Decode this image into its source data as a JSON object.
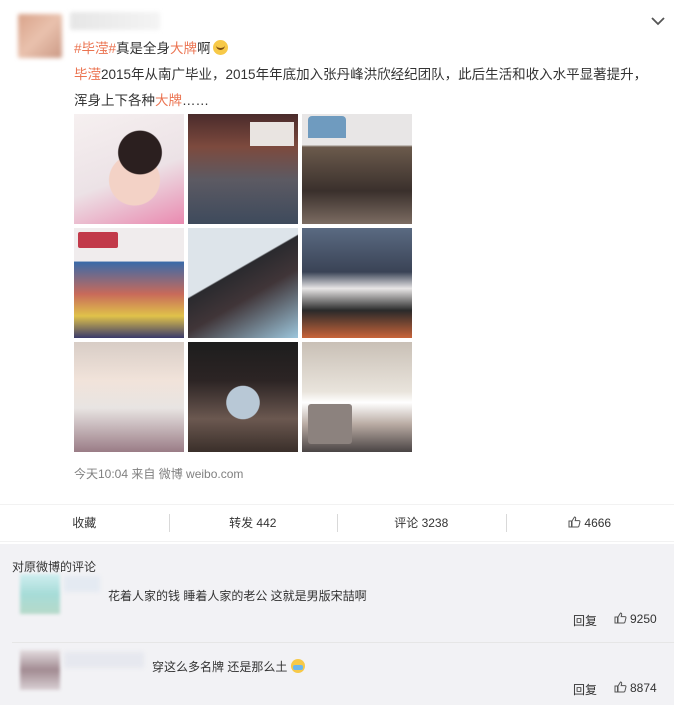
{
  "post": {
    "hashtag1": "#毕滢#",
    "text1": "真是全身",
    "highlight1": "大牌",
    "text2": "啊",
    "line2_highlight": "毕滢",
    "line2_text": "2015年从南广毕业，2015年年底加入张丹峰洪欣经纪团队，此后生活和收入水平显著提升，",
    "line3_text": "浑身上下各种",
    "line3_highlight": "大牌",
    "line3_tail": "……",
    "meta": "今天10:04 来自 微博 weibo.com"
  },
  "actions": {
    "favorite": "收藏",
    "repost": "转发 442",
    "comment": "评论 3238",
    "like": "4666"
  },
  "comments": {
    "section_title": "对原微博的评论",
    "items": [
      {
        "text": "花着人家的钱 睡着人家的老公 这就是男版宋喆啊",
        "reply": "回复",
        "likes": "9250"
      },
      {
        "text": "穿这么多名牌 还是那么土",
        "reply": "回复",
        "likes": "8874"
      }
    ]
  },
  "colors": {
    "accent": "#eb7350",
    "like": "#f4a21c"
  },
  "icons": {
    "chevron": "chevron-down-icon",
    "thumb": "thumb-up-icon",
    "emoji": "doge-emoji-icon"
  }
}
